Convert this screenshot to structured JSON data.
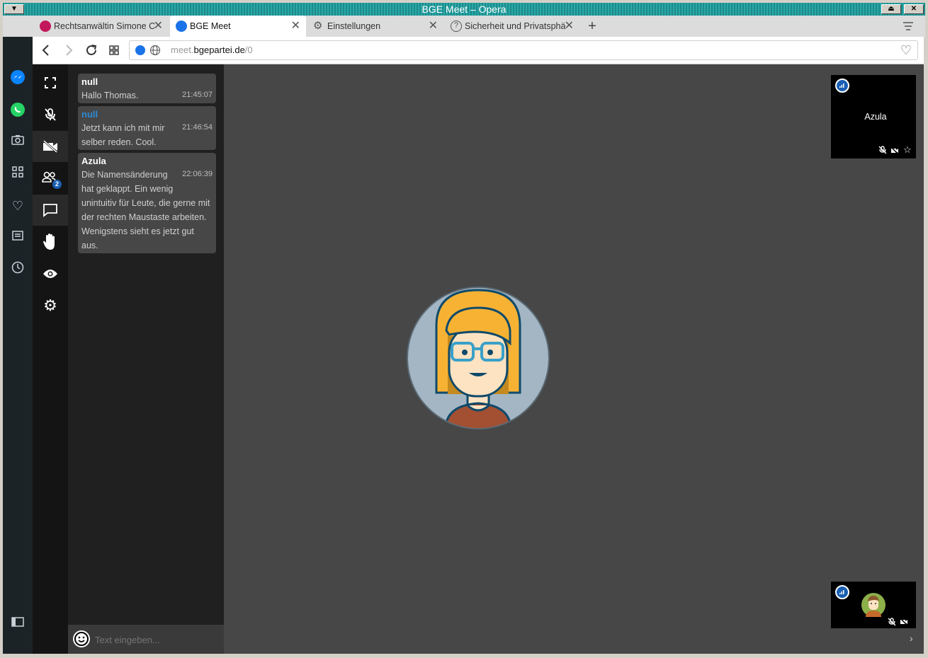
{
  "window": {
    "title": "BGE Meet – Opera"
  },
  "tabs": [
    {
      "label": "Rechtsanwältin Simone C",
      "icon": "scales-icon",
      "color": "#c2185b"
    },
    {
      "label": "BGE Meet",
      "icon": "bge-icon",
      "color": "#1a73e8"
    },
    {
      "label": "Einstellungen",
      "icon": "gear-icon",
      "color": "#555555"
    },
    {
      "label": "Sicherheit und Privatsphä",
      "icon": "help-icon",
      "color": "#555555"
    }
  ],
  "address": {
    "prefix": "meet.",
    "domain": "bgepartei.de",
    "path": "/0"
  },
  "opera_sidebar": [
    "opera-logo",
    "messenger-icon",
    "whatsapp-icon",
    "camera-icon",
    "apps-icon",
    "heart-icon",
    "news-icon",
    "history-icon",
    "sidebar-toggle-icon"
  ],
  "toolbar": [
    "fullscreen-icon",
    "mic-off-icon",
    "camera-off-icon",
    "participants-icon",
    "chat-icon",
    "raise-hand-icon",
    "eye-icon",
    "settings-icon"
  ],
  "participants_badge": "2",
  "chat": {
    "messages": [
      {
        "sender": "null",
        "time": "21:45:07",
        "lines": [
          "Hallo Thomas."
        ]
      },
      {
        "sender": "null",
        "time": "21:46:54",
        "lines": [
          "Jetzt kann ich mit mir",
          "selber reden. Cool."
        ]
      },
      {
        "sender": "Azula",
        "time": "22:06:39",
        "lines": [
          "Die Namensänderung",
          "hat geklappt. Ein wenig",
          "unintuitiv für Leute, die gerne mit",
          "der rechten Maustaste arbeiten.",
          "Wenigstens sieht es jetzt gut",
          "aus."
        ]
      }
    ],
    "input_placeholder": "Text eingeben..."
  },
  "thumbs": [
    {
      "name": "Azula"
    }
  ],
  "colors": {
    "accent": "#1a5fb4",
    "stage": "#474747",
    "chat_bg": "#202020"
  }
}
